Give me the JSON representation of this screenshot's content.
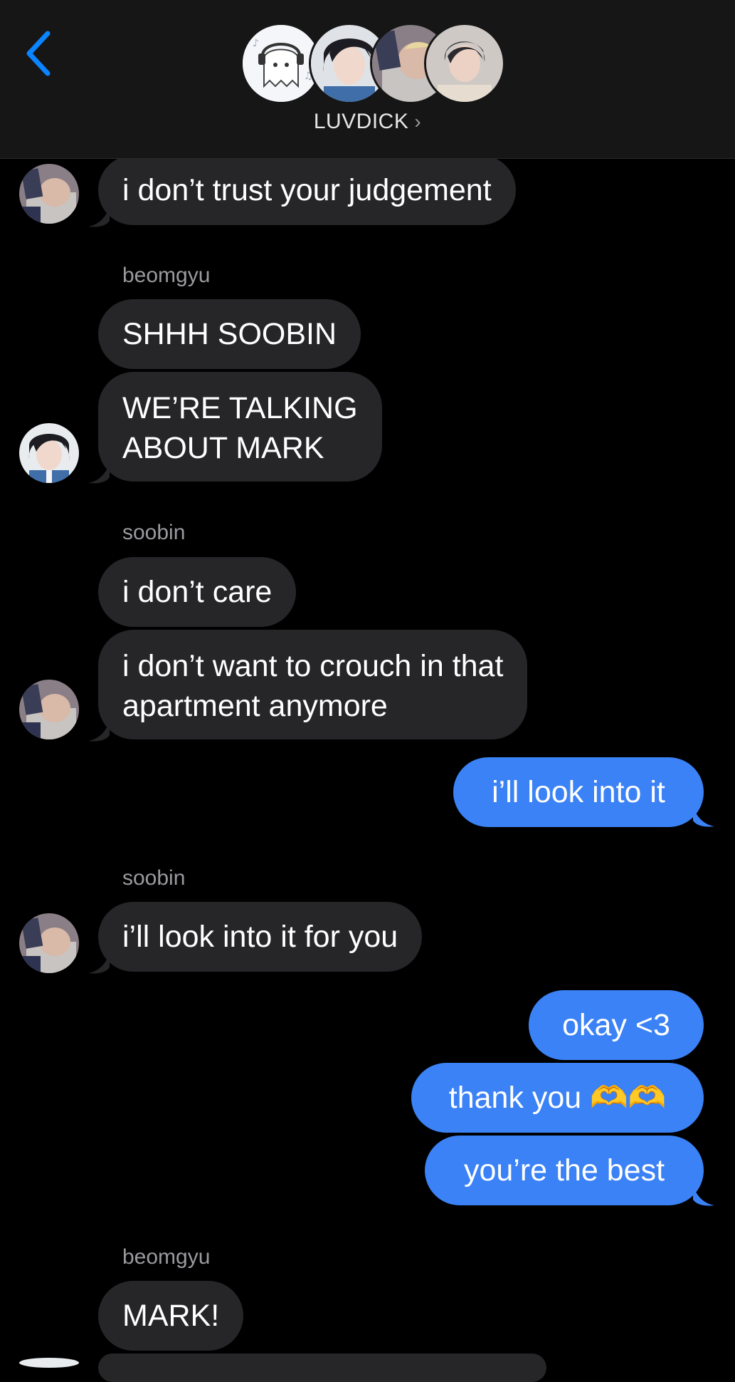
{
  "header": {
    "group_name": "LUVDICK",
    "chevron": "›",
    "back_icon": "chevron-left-icon",
    "accent": "#0a84ff"
  },
  "messages": [
    {
      "sender": "",
      "text": "i don’t trust your judgement"
    },
    {
      "sender": "beomgyu",
      "text": "SHHH SOOBIN"
    },
    {
      "sender": "",
      "text_lines": [
        "WE’RE TALKING",
        "ABOUT MARK"
      ]
    },
    {
      "sender": "soobin",
      "text": "i don’t care"
    },
    {
      "sender": "",
      "text_lines": [
        "i don’t want to crouch in that",
        "apartment anymore"
      ]
    },
    {
      "sender": "me",
      "text": "i’ll look into it"
    },
    {
      "sender": "soobin",
      "text": "i’ll look into it for you"
    },
    {
      "sender": "me",
      "text": "okay <3"
    },
    {
      "sender": "me",
      "text": "thank you 🫶🫶"
    },
    {
      "sender": "me",
      "text": "you’re the best"
    },
    {
      "sender": "beomgyu",
      "text": "MARK!"
    }
  ],
  "senders": {
    "beomgyu_1": "beomgyu",
    "soobin_1": "soobin",
    "soobin_2": "soobin",
    "beomgyu_2": "beomgyu"
  },
  "colors": {
    "incoming_bubble": "#262629",
    "outgoing_bubble": "#3b82f6",
    "background": "#000000",
    "header_bg": "#161616"
  }
}
